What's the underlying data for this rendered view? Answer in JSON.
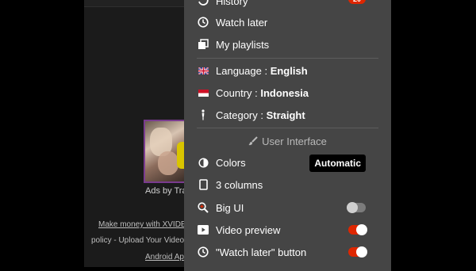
{
  "background_page": {
    "ads_by": "Ads by Tra",
    "links": [
      "Make money with XVIDE",
      "policy - Upload Your Video",
      "Android Ap"
    ]
  },
  "menu": {
    "history": {
      "label": "History",
      "badge": "20",
      "icon": "history-icon"
    },
    "watch_later": {
      "label": "Watch later",
      "icon": "clock-icon"
    },
    "my_playlists": {
      "label": "My playlists",
      "icon": "playlist-icon"
    },
    "language": {
      "prefix": "Language : ",
      "value": "English",
      "icon": "uk-flag-icon"
    },
    "country": {
      "prefix": "Country : ",
      "value": "Indonesia",
      "icon": "indonesia-flag-icon"
    },
    "category": {
      "prefix": "Category : ",
      "value": "Straight",
      "icon": "person-icon"
    },
    "ui_section": {
      "label": "User Interface",
      "icon": "brush-icon"
    },
    "colors": {
      "label": "Colors",
      "value": "Automatic",
      "icon": "contrast-icon"
    },
    "columns": {
      "label": "3 columns",
      "icon": "tablet-icon"
    },
    "big_ui": {
      "label": "Big UI",
      "enabled": false,
      "icon": "zoom-in-icon"
    },
    "video_preview": {
      "label": "Video preview",
      "enabled": true,
      "icon": "play-icon"
    },
    "watch_later_button": {
      "label": "\"Watch later\" button",
      "enabled": true,
      "icon": "clock-icon"
    }
  },
  "colors": {
    "accent": "#de2600",
    "menu_bg": "#454545",
    "page_bg": "#1b1b1b"
  }
}
